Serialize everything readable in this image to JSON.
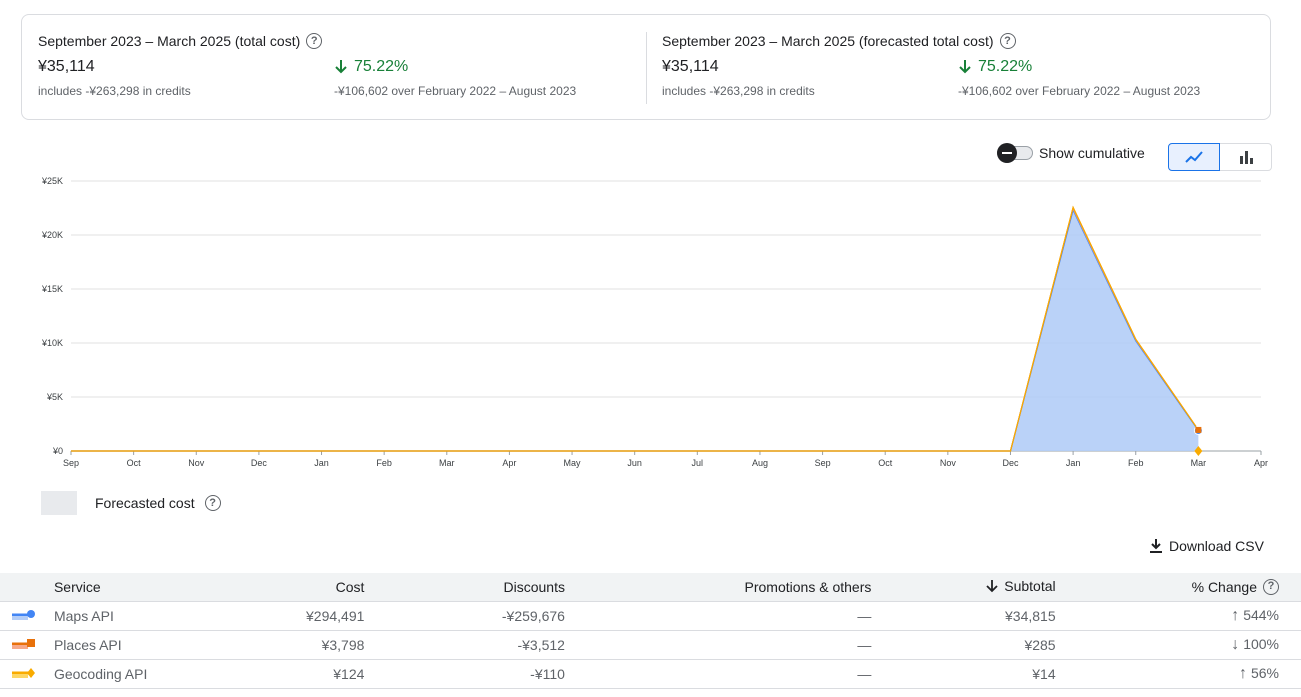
{
  "summary": {
    "left": {
      "title": "September 2023 – March 2025 (total cost)",
      "amount": "¥35,114",
      "credits": "includes -¥263,298 in credits",
      "change": "75.22%",
      "change_sub": "-¥106,602 over February 2022 – August 2023"
    },
    "right": {
      "title": "September 2023 – March 2025 (forecasted total cost)",
      "amount": "¥35,114",
      "credits": "includes -¥263,298 in credits",
      "change": "75.22%",
      "change_sub": "-¥106,602 over February 2022 – August 2023"
    },
    "help_icon": "help-circle-icon",
    "change_icon": "arrow-down-icon"
  },
  "controls": {
    "cumulative_label": "Show cumulative",
    "cumulative_on": false,
    "line_view_icon": "line-chart-icon",
    "bar_view_icon": "bar-chart-icon"
  },
  "chart_data": {
    "type": "area",
    "categories": [
      "Sep",
      "Oct",
      "Nov",
      "Dec",
      "Jan",
      "Feb",
      "Mar",
      "Apr",
      "May",
      "Jun",
      "Jul",
      "Aug",
      "Sep",
      "Oct",
      "Nov",
      "Dec",
      "Jan",
      "Feb",
      "Mar",
      "Apr"
    ],
    "y_ticks": [
      "¥0",
      "¥5K",
      "¥10K",
      "¥15K",
      "¥20K",
      "¥25K"
    ],
    "ylim": [
      0,
      25000
    ],
    "stacked": true,
    "grid": true,
    "series": [
      {
        "color": "#4285f4",
        "fill": "#b3cdf7",
        "values": [
          0,
          0,
          0,
          0,
          0,
          0,
          0,
          0,
          0,
          0,
          0,
          0,
          0,
          0,
          0,
          0,
          22300,
          10200,
          1900,
          null
        ]
      },
      {
        "color": "#e8710a",
        "fill": "#f6a98a",
        "values": [
          0,
          0,
          0,
          0,
          0,
          0,
          0,
          0,
          0,
          0,
          0,
          0,
          0,
          0,
          0,
          0,
          250,
          150,
          50,
          null
        ]
      },
      {
        "color": "#f9ab00",
        "fill": "#fdd663",
        "values": [
          0,
          0,
          0,
          0,
          0,
          0,
          0,
          0,
          0,
          0,
          0,
          0,
          0,
          0,
          0,
          0,
          10,
          5,
          2,
          null
        ]
      }
    ]
  },
  "legend": {
    "forecast_label": "Forecasted cost"
  },
  "download": {
    "label": "Download CSV",
    "icon": "download-icon"
  },
  "table": {
    "headers": {
      "service": "Service",
      "cost": "Cost",
      "discounts": "Discounts",
      "promotions": "Promotions & others",
      "subtotal": "Subtotal",
      "change": "% Change"
    },
    "sort_icon": "arrow-down-icon",
    "rows": [
      {
        "service": "Maps API",
        "cost": "¥294,491",
        "discounts": "-¥259,676",
        "promotions": "—",
        "subtotal": "¥34,815",
        "change": "544%",
        "direction": "up",
        "color": "#4285f4"
      },
      {
        "service": "Places API",
        "cost": "¥3,798",
        "discounts": "-¥3,512",
        "promotions": "—",
        "subtotal": "¥285",
        "change": "100%",
        "direction": "down",
        "color": "#e8710a"
      },
      {
        "service": "Geocoding API",
        "cost": "¥124",
        "discounts": "-¥110",
        "promotions": "—",
        "subtotal": "¥14",
        "change": "56%",
        "direction": "up",
        "color": "#f9ab00"
      }
    ]
  }
}
